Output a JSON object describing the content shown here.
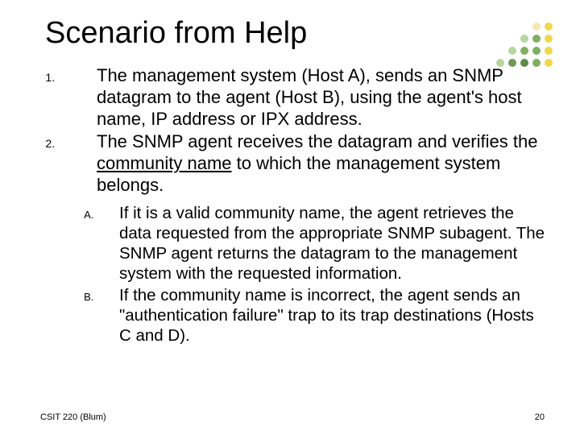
{
  "title": "Scenario from Help",
  "items": [
    {
      "text": "The management system (Host A), sends an SNMP datagram to the agent (Host B), using the agent's host name, IP address or IPX address."
    },
    {
      "pre": "The SNMP agent receives the datagram and verifies the ",
      "link": "community name",
      "post": " to which the management system belongs."
    }
  ],
  "subitems": [
    "If it is a valid community name, the agent retrieves the data requested from the appropriate SNMP subagent. The SNMP agent returns the datagram to the management system with the requested information.",
    "If the community name is incorrect, the agent sends an \"authentication failure\" trap to its trap destinations (Hosts C and D)."
  ],
  "footer_left": "CSIT 220 (Blum)",
  "footer_right": "20"
}
